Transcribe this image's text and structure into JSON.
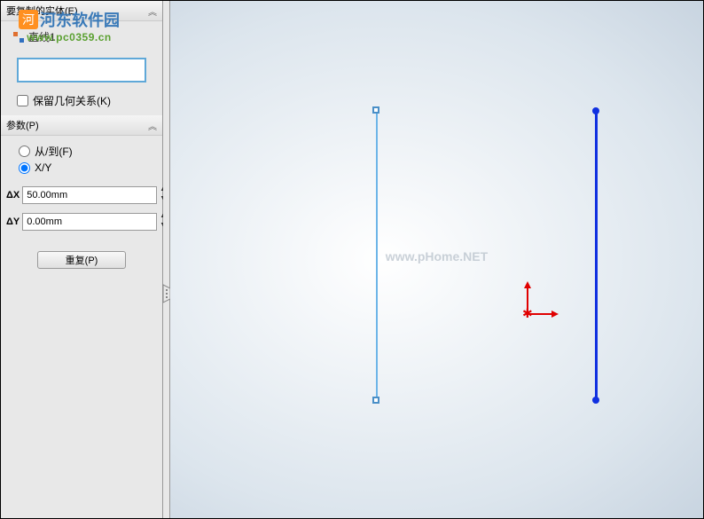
{
  "sections": {
    "entities": {
      "title": "要复制的实体(E)",
      "item": "直线1",
      "keep_relations": "保留几何关系(K)"
    },
    "params": {
      "title": "参数(P)",
      "from_to": "从/到(F)",
      "xy": "X/Y",
      "dx_label": "ΔX",
      "dx_value": "50.00mm",
      "dy_label": "ΔY",
      "dy_value": "0.00mm"
    }
  },
  "buttons": {
    "repeat": "重复(P)"
  },
  "watermark": {
    "logo_char": "河",
    "main": "河东软件园",
    "url": "www.pc0359.cn",
    "center": "www.pHome.NET"
  }
}
